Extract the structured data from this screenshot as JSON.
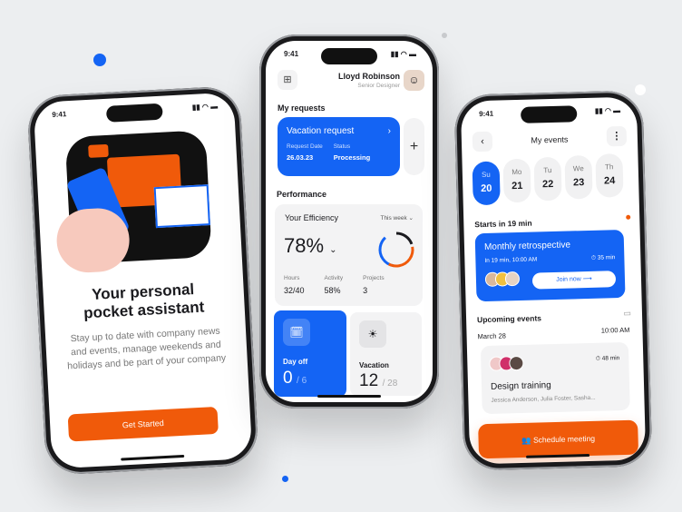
{
  "colors": {
    "accent_blue": "#1464f4",
    "accent_orange": "#f05a0a",
    "background": "#eceef0"
  },
  "status_time": "9:41",
  "onboarding": {
    "title": "Your personal pocket assistant",
    "description": "Stay up to date with company news and events, manage weekends and holidays and be part of your company",
    "cta": "Get Started"
  },
  "dashboard": {
    "user_name": "Lloyd Robinson",
    "user_role": "Senior Designer",
    "my_requests_label": "My requests",
    "request": {
      "title": "Vacation request",
      "date_label": "Request Date",
      "date": "26.03.23",
      "status_label": "Status",
      "status": "Processing"
    },
    "performance_label": "Performance",
    "efficiency": {
      "title": "Your Efficiency",
      "period": "This week",
      "value": "78%",
      "progress": 78,
      "stats": [
        {
          "label": "Hours",
          "value": "32/40"
        },
        {
          "label": "Activity",
          "value": "58%"
        },
        {
          "label": "Projects",
          "value": "3"
        }
      ]
    },
    "tiles": [
      {
        "label": "Day off",
        "value": "0",
        "total": "/ 6"
      },
      {
        "label": "Vacation",
        "value": "12",
        "total": "/ 28"
      }
    ]
  },
  "events": {
    "title": "My events",
    "days": [
      {
        "d": "Su",
        "n": "20"
      },
      {
        "d": "Mo",
        "n": "21"
      },
      {
        "d": "Tu",
        "n": "22"
      },
      {
        "d": "We",
        "n": "23"
      },
      {
        "d": "Th",
        "n": "24"
      }
    ],
    "starts_label": "Starts in 19 min",
    "current": {
      "title": "Monthly retrospective",
      "time": "In 19 min, 10:00 AM",
      "duration": "35 min",
      "join": "Join now"
    },
    "upcoming_label": "Upcoming events",
    "upcoming": {
      "date": "March 28",
      "time": "10:00 AM",
      "duration": "48 min",
      "title": "Design training",
      "attendees": "Jessica Anderson, Julia Foster, Sasha..."
    },
    "schedule_button": "Schedule meeting"
  }
}
